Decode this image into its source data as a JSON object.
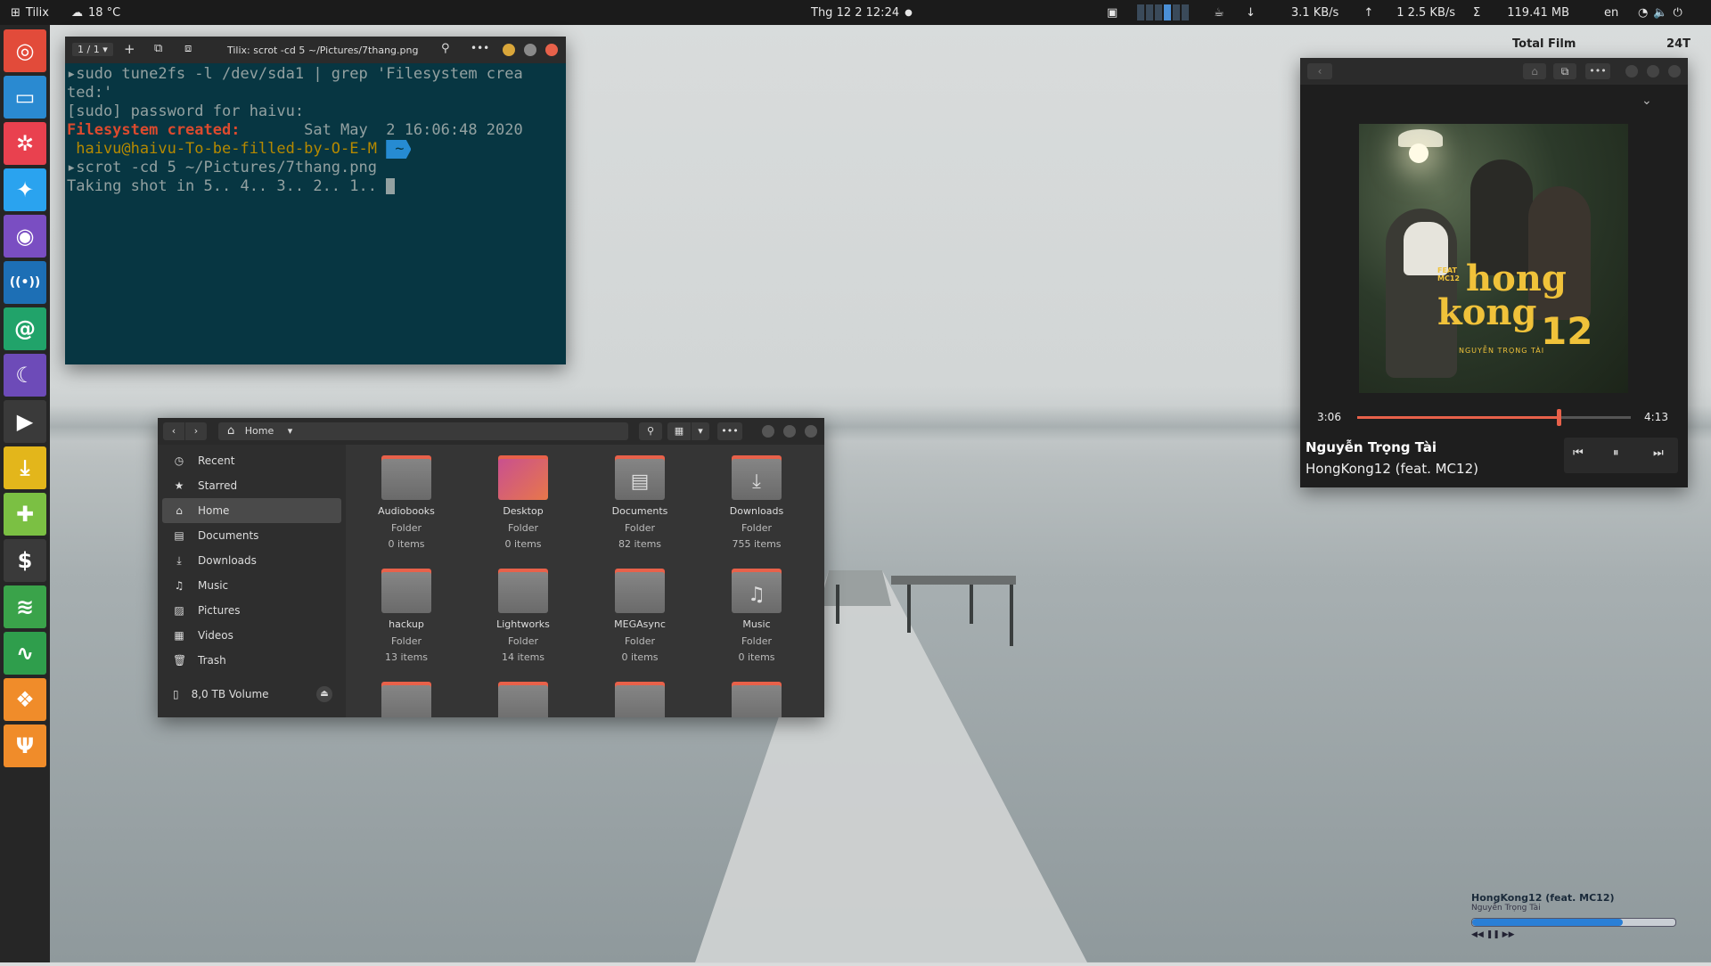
{
  "topbar": {
    "app": "Tilix",
    "weather": "18 °C",
    "datetime": "Thg 12 2  12:24",
    "down_speed": "3.1 KB/s",
    "up_speed": "1 2.5 KB/s",
    "total": "Σ",
    "memory": "119.41 MB",
    "lang": "en",
    "accent": "#4a8fd6"
  },
  "dock": {
    "items": [
      {
        "name": "chrome-icon",
        "glyph": "◎",
        "color": "#e24b3a"
      },
      {
        "name": "files-icon",
        "glyph": "▭",
        "color": "#2a8ad1"
      },
      {
        "name": "pinwheel-icon",
        "glyph": "✲",
        "color": "#e9414f"
      },
      {
        "name": "twitter-icon",
        "glyph": "✦",
        "color": "#2aa3ef"
      },
      {
        "name": "podcast-icon",
        "glyph": "◉",
        "color": "#7a4ec2"
      },
      {
        "name": "radio-icon",
        "glyph": "((•))",
        "color": "#1d6fb5"
      },
      {
        "name": "mail-icon",
        "glyph": "@",
        "color": "#21a36a"
      },
      {
        "name": "wave-icon",
        "glyph": "☾",
        "color": "#6d4bb8"
      },
      {
        "name": "play-icon",
        "glyph": "▶",
        "color": "#3a3a3a"
      },
      {
        "name": "download-icon",
        "glyph": "⤓",
        "color": "#e3b61b"
      },
      {
        "name": "gamepad-icon",
        "glyph": "✚",
        "color": "#7bc043"
      },
      {
        "name": "dollar-icon",
        "glyph": "$",
        "color": "#3a3a3a"
      },
      {
        "name": "spotify-icon",
        "glyph": "≋",
        "color": "#3aa34a"
      },
      {
        "name": "pulse-icon",
        "glyph": "∿",
        "color": "#2f9e4c"
      },
      {
        "name": "pineapple-icon",
        "glyph": "❖",
        "color": "#f08c2a"
      },
      {
        "name": "fork-icon",
        "glyph": "Ψ",
        "color": "#f08c2a"
      }
    ]
  },
  "terminal": {
    "tab_count": "1 / 1",
    "title": "Tilix: scrot -cd 5 ~/Pictures/7thang.png",
    "lines": {
      "l1": "▸sudo tune2fs -l /dev/sda1 | grep 'Filesystem crea",
      "l2": "ted:'",
      "l3": "[sudo] password for haivu:",
      "l4_label": "Filesystem created:",
      "l4_value": "       Sat May  2 16:06:48 2020",
      "l5_user": " haivu@haivu-To-be-filled-by-O-E-M ",
      "l5_dir": "~",
      "l6": "▸scrot -cd 5 ~/Pictures/7thang.png",
      "l7": "Taking shot in 5.. 4.. 3.. 2.. 1.. "
    }
  },
  "files": {
    "location": "Home",
    "sidebar": [
      {
        "name": "sidebar-item-recent",
        "icon": "◷",
        "label": "Recent"
      },
      {
        "name": "sidebar-item-starred",
        "icon": "★",
        "label": "Starred"
      },
      {
        "name": "sidebar-item-home",
        "icon": "⌂",
        "label": "Home"
      },
      {
        "name": "sidebar-item-documents",
        "icon": "▤",
        "label": "Documents"
      },
      {
        "name": "sidebar-item-downloads",
        "icon": "⤓",
        "label": "Downloads"
      },
      {
        "name": "sidebar-item-music",
        "icon": "♫",
        "label": "Music"
      },
      {
        "name": "sidebar-item-pictures",
        "icon": "▨",
        "label": "Pictures"
      },
      {
        "name": "sidebar-item-videos",
        "icon": "▦",
        "label": "Videos"
      },
      {
        "name": "sidebar-item-trash",
        "icon": "🗑",
        "label": "Trash"
      }
    ],
    "volume": "8,0 TB Volume",
    "folders": [
      {
        "name": "Audiobooks",
        "type": "Folder",
        "count": "0 items",
        "glyph": ""
      },
      {
        "name": "Desktop",
        "type": "Folder",
        "count": "0 items",
        "glyph": ""
      },
      {
        "name": "Documents",
        "type": "Folder",
        "count": "82 items",
        "glyph": "▤"
      },
      {
        "name": "Downloads",
        "type": "Folder",
        "count": "755 items",
        "glyph": "⤓"
      },
      {
        "name": "hackup",
        "type": "Folder",
        "count": "13 items",
        "glyph": ""
      },
      {
        "name": "Lightworks",
        "type": "Folder",
        "count": "14 items",
        "glyph": ""
      },
      {
        "name": "MEGAsync",
        "type": "Folder",
        "count": "0 items",
        "glyph": ""
      },
      {
        "name": "Music",
        "type": "Folder",
        "count": "0 items",
        "glyph": "♫"
      }
    ]
  },
  "player": {
    "elapsed": "3:06",
    "duration": "4:13",
    "progress": 0.735,
    "artist": "Nguyễn Trọng Tài",
    "track": "HongKong12 (feat. MC12)",
    "album_text_1": "hong",
    "album_text_2": "kong",
    "album_text_3": "12",
    "album_feat": "FEAT MC12",
    "album_artist": "NGUYỄN TRỌNG TÀI"
  },
  "desktop_widget": {
    "heading": "Total Film",
    "value": "24T"
  },
  "mini_player": {
    "track": "HongKong12 (feat. MC12)",
    "artist": "Nguyễn Trọng Tài",
    "progress": 0.74,
    "controls": "◀◀ ❚❚ ▶▶"
  }
}
